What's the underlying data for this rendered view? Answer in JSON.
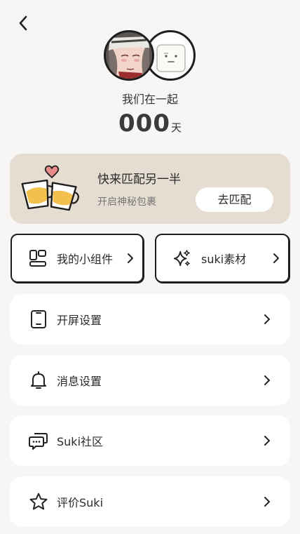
{
  "header": {
    "back_icon": "chevron-left-icon"
  },
  "couple": {
    "together_label": "我们在一起",
    "days_value": "000",
    "days_unit": "天"
  },
  "match_card": {
    "title": "快来匹配另一半",
    "subtitle": "开启神秘包裹",
    "button_label": "去匹配",
    "icon": "coffee-cups-heart-icon"
  },
  "quick_boxes": [
    {
      "label": "我的小组件",
      "icon": "widgets-icon"
    },
    {
      "label": "suki素材",
      "icon": "sparkle-icon"
    }
  ],
  "menu": [
    {
      "label": "开屏设置",
      "icon": "phone-icon"
    },
    {
      "label": "消息设置",
      "icon": "bell-icon"
    },
    {
      "label": "Suki社区",
      "icon": "chat-bubbles-icon"
    },
    {
      "label": "评价Suki",
      "icon": "star-icon"
    }
  ],
  "colors": {
    "background": "#f8f6f4",
    "card_beige": "#e6ddd2",
    "heart_pink": "#e78a8a",
    "tea_yellow": "#f2c04e"
  }
}
